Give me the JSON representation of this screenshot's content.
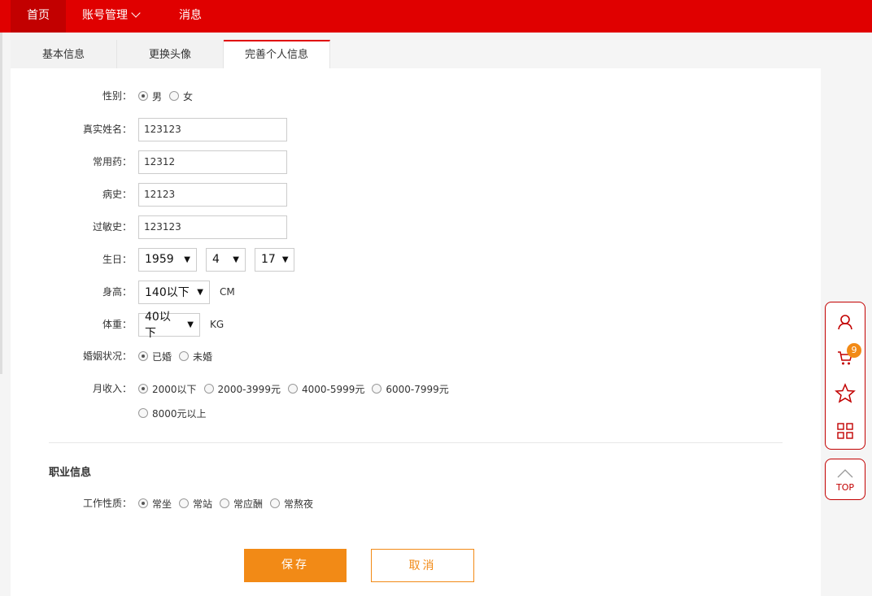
{
  "topnav": {
    "home": "首页",
    "account": "账号管理",
    "messages": "消息"
  },
  "tabs": [
    "基本信息",
    "更换头像",
    "完善个人信息"
  ],
  "form": {
    "gender": {
      "label": "性别：",
      "options": [
        "男",
        "女"
      ],
      "selected": "男"
    },
    "real_name": {
      "label": "真实姓名：",
      "value": "123123"
    },
    "common_medicine": {
      "label": "常用药：",
      "value": "12312"
    },
    "medical_history": {
      "label": "病史：",
      "value": "12123"
    },
    "allergy_history": {
      "label": "过敏史：",
      "value": "123123"
    },
    "birthday": {
      "label": "生日：",
      "year": "1959",
      "month": "4",
      "day": "17"
    },
    "height": {
      "label": "身高：",
      "value": "140以下",
      "unit": "CM"
    },
    "weight": {
      "label": "体重：",
      "value": "40以下",
      "unit": "KG"
    },
    "marital": {
      "label": "婚姻状况：",
      "options": [
        "已婚",
        "未婚"
      ],
      "selected": "已婚"
    },
    "income": {
      "label": "月收入：",
      "options": [
        "2000以下",
        "2000-3999元",
        "4000-5999元",
        "6000-7999元",
        "8000元以上"
      ],
      "selected": "2000以下"
    }
  },
  "occupation": {
    "section_title": "职业信息",
    "work_nature": {
      "label": "工作性质：",
      "options": [
        "常坐",
        "常站",
        "常应酬",
        "常熬夜"
      ],
      "selected": "常坐"
    }
  },
  "buttons": {
    "save": "保存",
    "cancel": "取消"
  },
  "sidebar": {
    "icons": [
      "user-icon",
      "cart-icon",
      "star-icon",
      "qrcode-icon"
    ],
    "cart_count": "9",
    "top_label": "TOP"
  },
  "colors": {
    "brand_red": "#e00000",
    "accent_orange": "#f28a16"
  }
}
